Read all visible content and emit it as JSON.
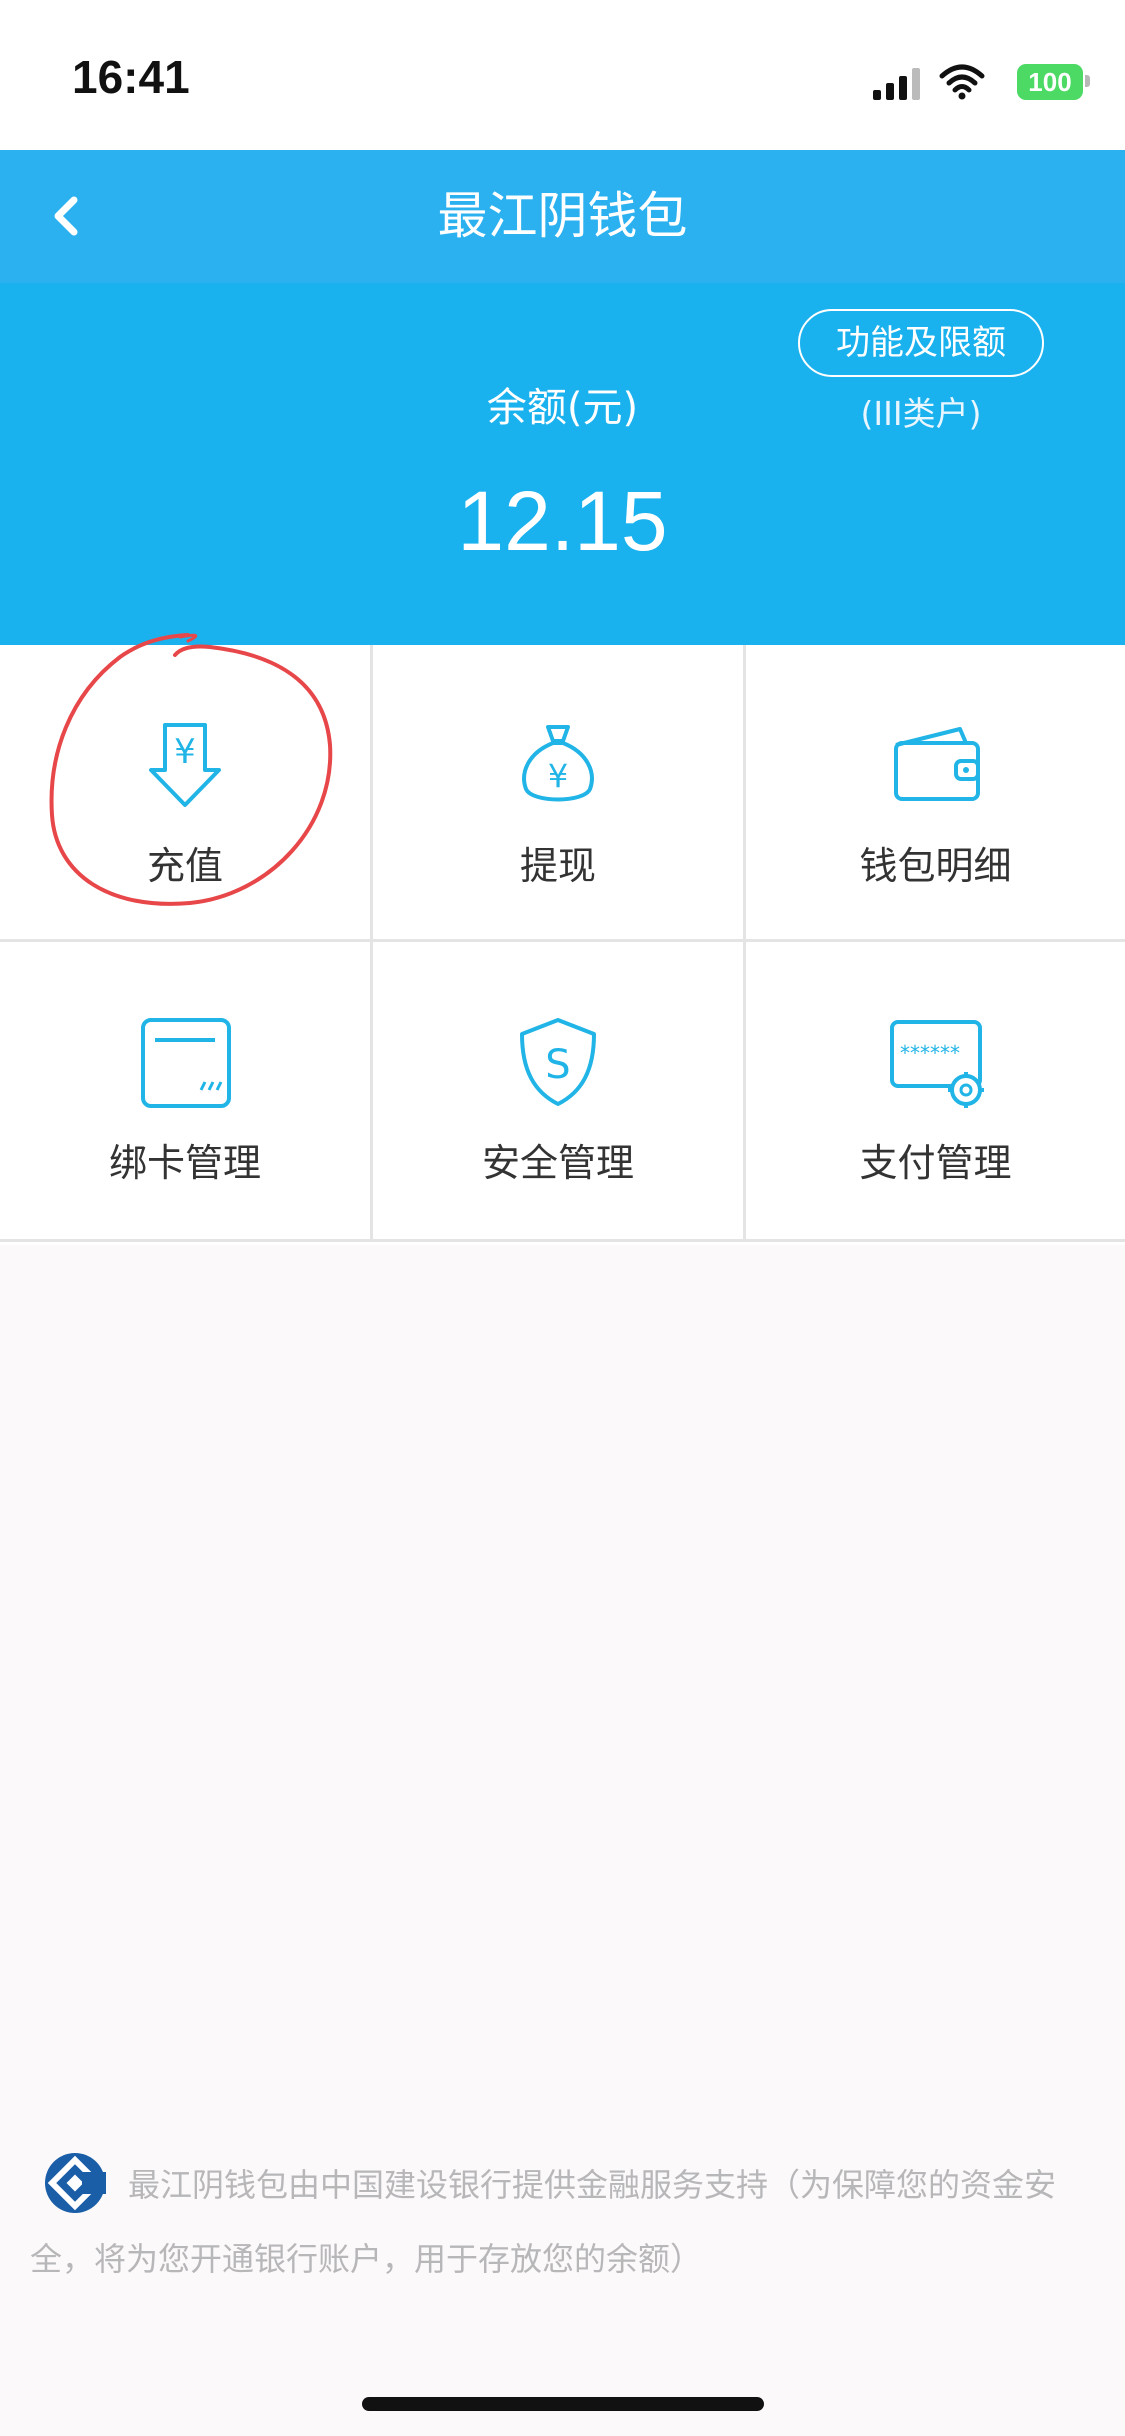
{
  "status_bar": {
    "time": "16:41",
    "battery": "100"
  },
  "nav": {
    "title": "最江阴钱包"
  },
  "balance": {
    "label": "余额(元)",
    "amount": "12.15",
    "limits_button": "功能及限额",
    "account_class": "(III类户)"
  },
  "menu": [
    {
      "label": "充值",
      "icon": "recharge-yuan-arrow-icon"
    },
    {
      "label": "提现",
      "icon": "money-bag-icon"
    },
    {
      "label": "钱包明细",
      "icon": "wallet-icon"
    },
    {
      "label": "绑卡管理",
      "icon": "bank-card-icon"
    },
    {
      "label": "安全管理",
      "icon": "shield-icon"
    },
    {
      "label": "支付管理",
      "icon": "payment-password-gear-icon"
    }
  ],
  "footer": {
    "note": "最江阴钱包由中国建设银行提供金融服务支持（为保障您的资金安全，将为您开通银行账户，用于存放您的余额）"
  },
  "colors": {
    "nav": "#2bb1f0",
    "panel": "#1ab2ee",
    "icon": "#21b4e6",
    "annotation": "#e8474a"
  }
}
